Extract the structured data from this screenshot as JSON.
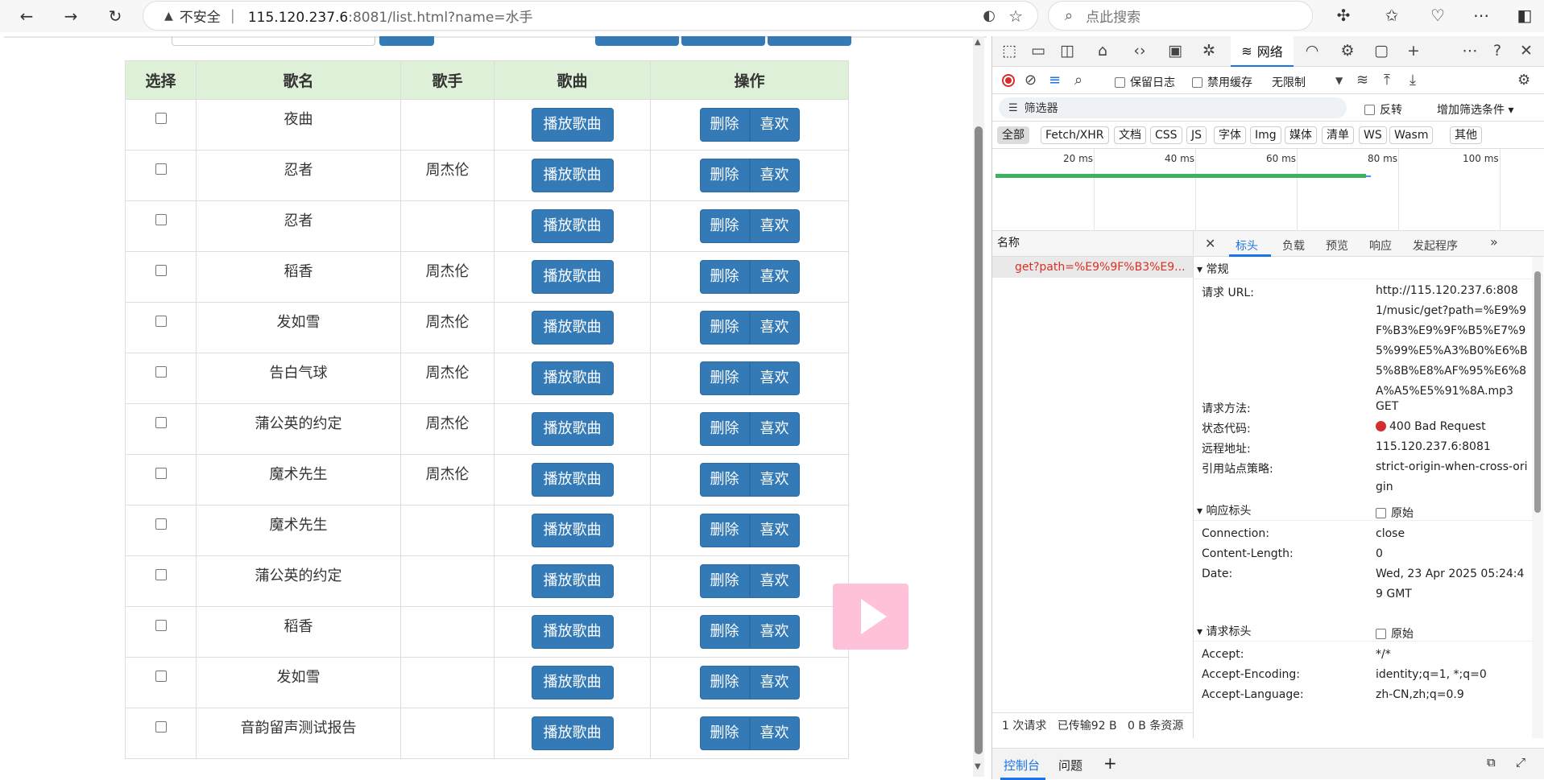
{
  "browser": {
    "insecure_label": "不安全",
    "separator": "|",
    "url_host": "115.120.237.6",
    "url_path": ":8081/list.html?name=水手",
    "search_placeholder": "点此搜索",
    "icons": [
      "back-icon",
      "forward-icon",
      "reload-icon",
      "warning-icon",
      "read-aloud-icon",
      "favorite-star-icon",
      "extensions-icon",
      "favorites-icon",
      "browser-essentials-icon",
      "more-icon",
      "sidebar-icon"
    ]
  },
  "table": {
    "headers": [
      "选择",
      "歌名",
      "歌手",
      "歌曲",
      "操作"
    ],
    "play_label": "播放歌曲",
    "delete_label": "删除",
    "like_label": "喜欢",
    "rows": [
      {
        "title": "夜曲",
        "artist": ""
      },
      {
        "title": "忍者",
        "artist": "周杰伦"
      },
      {
        "title": "忍者",
        "artist": ""
      },
      {
        "title": "稻香",
        "artist": "周杰伦"
      },
      {
        "title": "发如雪",
        "artist": "周杰伦"
      },
      {
        "title": "告白气球",
        "artist": "周杰伦"
      },
      {
        "title": "蒲公英的约定",
        "artist": "周杰伦"
      },
      {
        "title": "魔术先生",
        "artist": "周杰伦"
      },
      {
        "title": "魔术先生",
        "artist": ""
      },
      {
        "title": "蒲公英的约定",
        "artist": ""
      },
      {
        "title": "稻香",
        "artist": ""
      },
      {
        "title": "发如雪",
        "artist": ""
      },
      {
        "title": "音韵留声测试报告",
        "artist": ""
      }
    ]
  },
  "devtools": {
    "network_tab": "网络",
    "preserve_log": "保留日志",
    "disable_cache": "禁用缓存",
    "throttle": "无限制",
    "filter_placeholder": "筛选器",
    "invert": "反转",
    "more_filters": "增加筛选条件",
    "type_filters": [
      "全部",
      "Fetch/XHR",
      "文档",
      "CSS",
      "JS",
      "字体",
      "Img",
      "媒体",
      "清单",
      "WS",
      "Wasm",
      "其他"
    ],
    "timeline_labels": [
      "20 ms",
      "40 ms",
      "60 ms",
      "80 ms",
      "100 ms"
    ],
    "name_header": "名称",
    "request_name": "get?path=%E9%9F%B3%E9...",
    "status_bar": {
      "requests": "1 次请求",
      "transferred": "已传输92 B",
      "resources": "0 B 条资源"
    },
    "detail_tabs": [
      "标头",
      "负载",
      "预览",
      "响应",
      "发起程序"
    ],
    "general": {
      "section": "常规",
      "url_key": "请求 URL:",
      "url_value": "http://115.120.237.6:8081/music/get?path=%E9%9F%B3%E9%9F%B5%E7%95%99%E5%A3%B0%E6%B5%8B%E8%AF%95%E6%8A%A5%E5%91%8A.mp3",
      "method_key": "请求方法:",
      "method_value": "GET",
      "status_key": "状态代码:",
      "status_value": "400 Bad Request",
      "remote_key": "远程地址:",
      "remote_value": "115.120.237.6:8081",
      "referrer_key": "引用站点策略:",
      "referrer_value": "strict-origin-when-cross-origin"
    },
    "response_headers": {
      "section": "响应标头",
      "raw": "原始",
      "connection_key": "Connection:",
      "connection_value": "close",
      "length_key": "Content-Length:",
      "length_value": "0",
      "date_key": "Date:",
      "date_value": "Wed, 23 Apr 2025 05:24:49 GMT"
    },
    "request_headers": {
      "section": "请求标头",
      "raw": "原始",
      "accept_key": "Accept:",
      "accept_value": "*/*",
      "encoding_key": "Accept-Encoding:",
      "encoding_value": "identity;q=1, *;q=0",
      "language_key": "Accept-Language:",
      "language_value": "zh-CN,zh;q=0.9"
    },
    "drawer": {
      "console": "控制台",
      "issues": "问题",
      "add": "+"
    }
  },
  "colors": {
    "primary_button": "#337ab7",
    "table_header": "#dff0d8",
    "accent": "#1a73e8",
    "error": "#d93025"
  }
}
